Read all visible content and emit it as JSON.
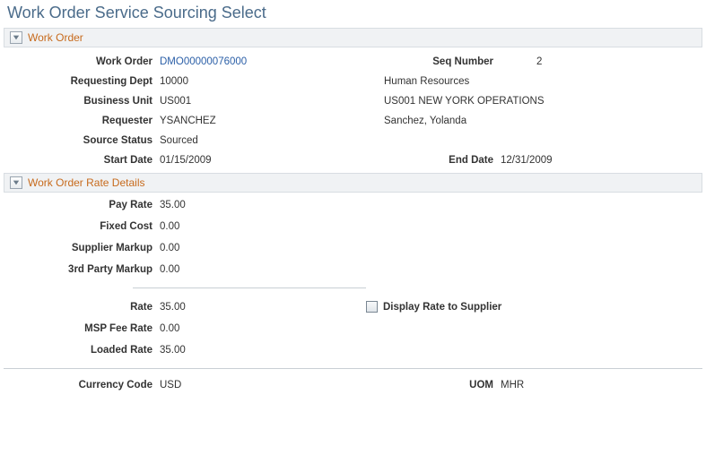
{
  "page": {
    "title": "Work Order Service Sourcing Select"
  },
  "sections": {
    "workOrder": {
      "title": "Work Order"
    },
    "rateDetails": {
      "title": "Work Order Rate Details"
    }
  },
  "workOrder": {
    "workOrder_label": "Work Order",
    "workOrder_link": "DMO00000076000",
    "seqNumber_label": "Seq Number",
    "seqNumber_value": "2",
    "requestingDept_label": "Requesting Dept",
    "requestingDept_value": "10000",
    "requestingDept_desc": "Human Resources",
    "businessUnit_label": "Business Unit",
    "businessUnit_value": "US001",
    "businessUnit_desc": "US001 NEW YORK OPERATIONS",
    "requester_label": "Requester",
    "requester_value": "YSANCHEZ",
    "requester_desc": "Sanchez, Yolanda",
    "sourceStatus_label": "Source Status",
    "sourceStatus_value": "Sourced",
    "startDate_label": "Start Date",
    "startDate_value": "01/15/2009",
    "endDate_label": "End Date",
    "endDate_value": "12/31/2009"
  },
  "rateDetails": {
    "payRate_label": "Pay Rate",
    "payRate_value": "35.00",
    "fixedCost_label": "Fixed Cost",
    "fixedCost_value": "0.00",
    "supplierMarkup_label": "Supplier Markup",
    "supplierMarkup_value": "0.00",
    "thirdPartyMarkup_label": "3rd Party Markup",
    "thirdPartyMarkup_value": "0.00",
    "rate_label": "Rate",
    "rate_value": "35.00",
    "displayRateToSupplier_label": "Display Rate to Supplier",
    "mspFeeRate_label": "MSP Fee Rate",
    "mspFeeRate_value": "0.00",
    "loadedRate_label": "Loaded Rate",
    "loadedRate_value": "35.00"
  },
  "footer": {
    "currencyCode_label": "Currency Code",
    "currencyCode_value": "USD",
    "uom_label": "UOM",
    "uom_value": "MHR"
  }
}
